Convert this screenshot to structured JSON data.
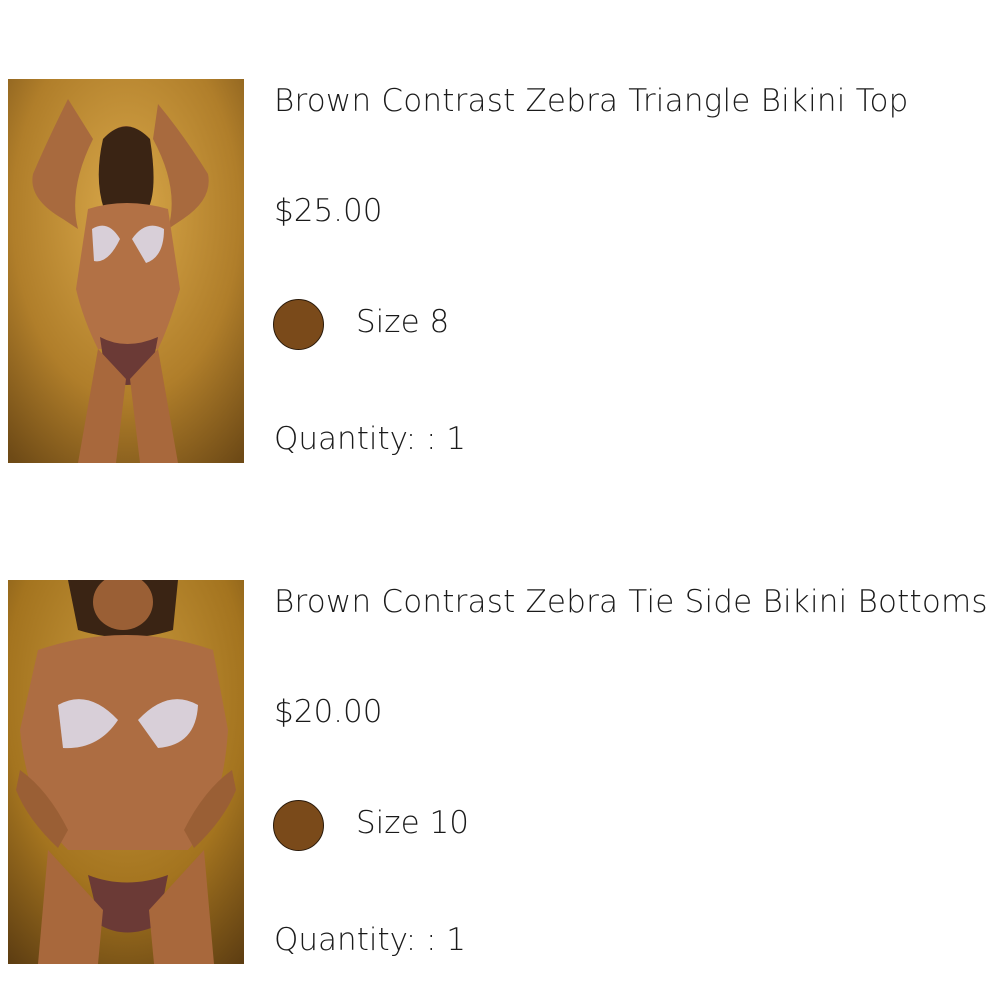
{
  "cart": {
    "items": [
      {
        "title": "Brown Contrast Zebra Triangle Bikini Top",
        "price": "$25.00",
        "swatch_color": "#7a4a1a",
        "size": "Size 8",
        "quantity": "Quantity: : 1"
      },
      {
        "title": "Brown Contrast Zebra Tie Side Bikini Bottoms",
        "price": "$20.00",
        "swatch_color": "#7a4a1a",
        "size": "Size 10",
        "quantity": "Quantity: : 1"
      }
    ]
  }
}
